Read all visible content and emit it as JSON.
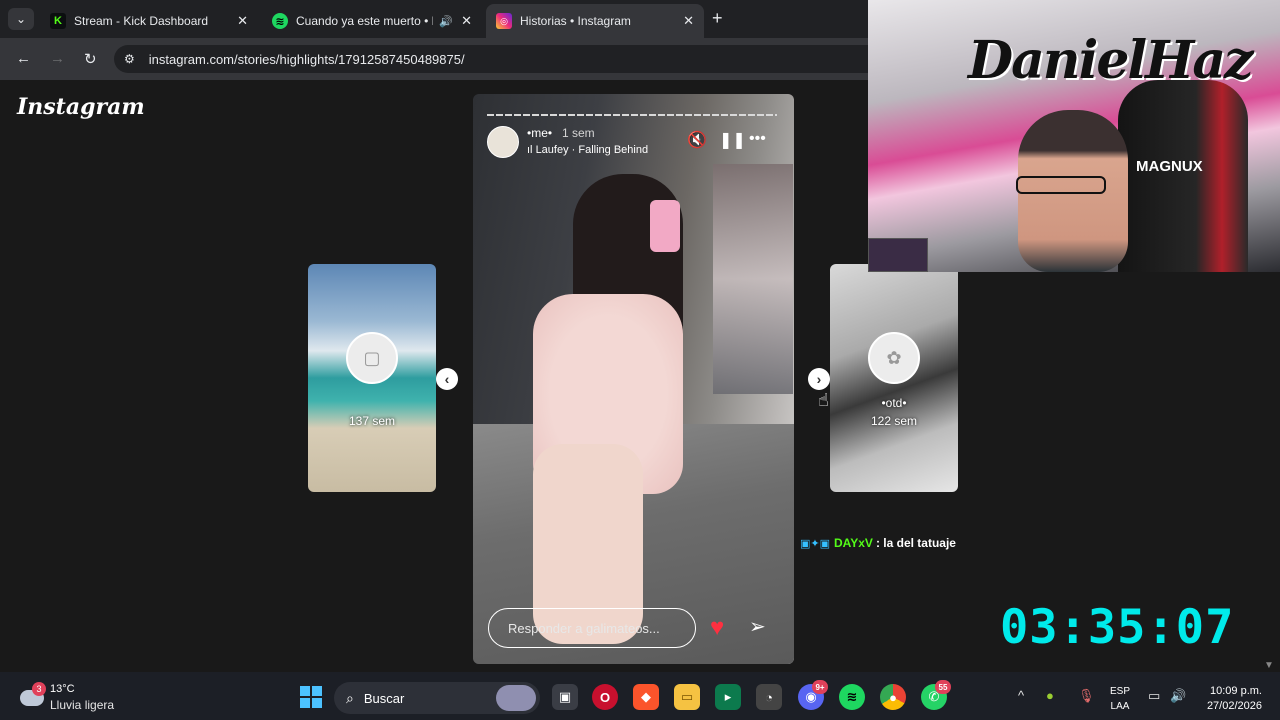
{
  "browser": {
    "tabs": [
      {
        "title": "Stream - Kick Dashboard",
        "favicon_icon": "kick-icon",
        "favicon_color": "#53fc18",
        "active": false
      },
      {
        "title": "Cuando ya este muerto • Pe",
        "favicon_icon": "spotify-icon",
        "favicon_color": "#1ed760",
        "active": false,
        "audio": true
      },
      {
        "title": "Historias • Instagram",
        "favicon_icon": "instagram-icon",
        "favicon_color": "#e1306c",
        "active": true
      }
    ],
    "url": "instagram.com/stories/highlights/17912587450489875/"
  },
  "instagram": {
    "logo": "Instagram",
    "left_highlight": {
      "time": "137 sem"
    },
    "right_highlight": {
      "name": "•otd•",
      "time": "122 sem"
    },
    "story": {
      "username": "•me•",
      "time": "1 sem",
      "music": "Laufey · Falling Behind",
      "reply_placeholder": "Responder a galimateos..."
    }
  },
  "stream": {
    "webcam_chair_label": "MAGNUX",
    "graffiti_text": "DanielHaz",
    "chat": {
      "user": "DAYxV",
      "message": ": la del tatuaje"
    },
    "timer": "03:35:07"
  },
  "taskbar": {
    "weather_badge": "3",
    "temperature": "13°C",
    "condition": "Lluvia ligera",
    "search_label": "Buscar",
    "discord_badge": "9+",
    "whatsapp_badge": "55",
    "lang_top": "ESP",
    "lang_bottom": "LAA",
    "time": "10:09 p.m.",
    "date": "27/02/2026"
  },
  "colors": {
    "accent_timer": "#00eaea",
    "chat_user": "#53fc18",
    "heart": "#ff3040"
  }
}
